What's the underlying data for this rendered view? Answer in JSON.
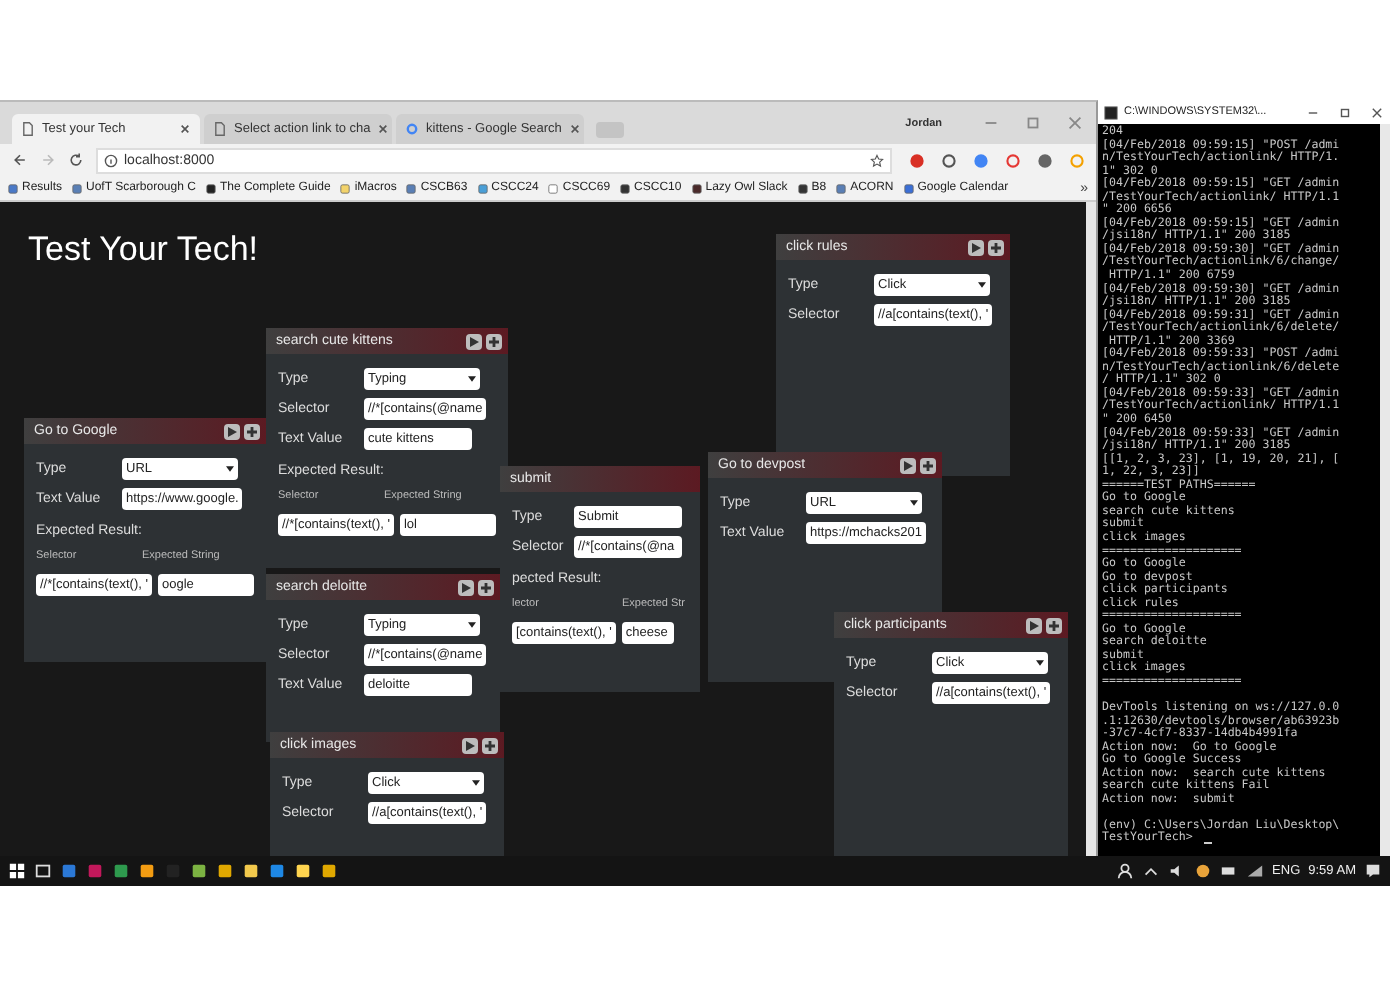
{
  "browser": {
    "tabs": [
      {
        "title": "Test your Tech",
        "selected": true
      },
      {
        "title": "Select action link to cha",
        "selected": false
      },
      {
        "title": "kittens - Google Search",
        "selected": false
      }
    ],
    "user": "Jordan",
    "address": "localhost:8000",
    "bookmarks": [
      "Results",
      "UofT Scarborough C",
      "The Complete Guide",
      "iMacros",
      "CSCB63",
      "CSCC24",
      "CSCC69",
      "CSCC10",
      "Lazy Owl Slack",
      "B8",
      "ACORN",
      "Google Calendar"
    ],
    "bookmarks_more": "»"
  },
  "page": {
    "title": "Test Your Tech!",
    "cards": [
      {
        "title": "Go to Google",
        "fields": [
          {
            "label": "Type",
            "kind": "select",
            "value": "URL"
          },
          {
            "label": "Text Value",
            "kind": "text",
            "value": "https://www.google."
          }
        ],
        "expected": {
          "heading": "Expected Result:",
          "selector_label": "Selector",
          "string_label": "Expected String",
          "selector_value": "//*[contains(text(), '",
          "string_value": "oogle"
        }
      },
      {
        "title": "search cute kittens",
        "fields": [
          {
            "label": "Type",
            "kind": "select",
            "value": "Typing"
          },
          {
            "label": "Selector",
            "kind": "text",
            "value": "//*[contains(@name"
          },
          {
            "label": "Text Value",
            "kind": "text",
            "value": "cute kittens"
          }
        ],
        "expected": {
          "heading": "Expected Result:",
          "selector_label": "Selector",
          "string_label": "Expected String",
          "selector_value": "//*[contains(text(), '",
          "string_value": "lol"
        }
      },
      {
        "title": "submit",
        "fields": [
          {
            "label": "Type",
            "kind": "text",
            "value": "Submit"
          },
          {
            "label": "Selector",
            "kind": "text",
            "value": "//*[contains(@na"
          }
        ],
        "expected": {
          "heading": "pected Result:",
          "selector_label": "lector",
          "string_label": "Expected Str",
          "selector_value": "[contains(text(), '",
          "string_value": "cheese"
        }
      },
      {
        "title": "search deloitte",
        "fields": [
          {
            "label": "Type",
            "kind": "select",
            "value": "Typing"
          },
          {
            "label": "Selector",
            "kind": "text",
            "value": "//*[contains(@name"
          },
          {
            "label": "Text Value",
            "kind": "text",
            "value": "deloitte"
          }
        ]
      },
      {
        "title": "click images",
        "fields": [
          {
            "label": "Type",
            "kind": "select",
            "value": "Click"
          },
          {
            "label": "Selector",
            "kind": "text",
            "value": "//a[contains(text(), '"
          }
        ]
      },
      {
        "title": "click rules",
        "fields": [
          {
            "label": "Type",
            "kind": "select",
            "value": "Click"
          },
          {
            "label": "Selector",
            "kind": "text",
            "value": "//a[contains(text(), '"
          }
        ]
      },
      {
        "title": "Go to devpost",
        "fields": [
          {
            "label": "Type",
            "kind": "select",
            "value": "URL"
          },
          {
            "label": "Text Value",
            "kind": "text",
            "value": "https://mchacks201"
          }
        ]
      },
      {
        "title": "click participants",
        "fields": [
          {
            "label": "Type",
            "kind": "select",
            "value": "Click"
          },
          {
            "label": "Selector",
            "kind": "text",
            "value": "//a[contains(text(), '"
          }
        ]
      }
    ]
  },
  "console": {
    "title": "C:\\WINDOWS\\SYSTEM32\\...",
    "blocks": [
      [
        "204",
        "[04/Feb/2018 09:59:15] \"POST /admi",
        "n/TestYourTech/actionlink/ HTTP/1.",
        "1\" 302 0",
        "[04/Feb/2018 09:59:15] \"GET /admin",
        "/TestYourTech/actionlink/ HTTP/1.1",
        "\" 200 6656",
        "[04/Feb/2018 09:59:15] \"GET /admin",
        "/jsi18n/ HTTP/1.1\" 200 3185",
        "[04/Feb/2018 09:59:30] \"GET /admin",
        "/TestYourTech/actionlink/6/change/",
        " HTTP/1.1\" 200 6759",
        "[04/Feb/2018 09:59:30] \"GET /admin",
        "/jsi18n/ HTTP/1.1\" 200 3185",
        "[04/Feb/2018 09:59:31] \"GET /admin",
        "/TestYourTech/actionlink/6/delete/",
        " HTTP/1.1\" 200 3369",
        "[04/Feb/2018 09:59:33] \"POST /admi",
        "n/TestYourTech/actionlink/6/delete",
        "/ HTTP/1.1\" 302 0",
        "[04/Feb/2018 09:59:33] \"GET /admin",
        "/TestYourTech/actionlink/ HTTP/1.1",
        "\" 200 6450",
        "[04/Feb/2018 09:59:33] \"GET /admin",
        "/jsi18n/ HTTP/1.1\" 200 3185",
        "[[1, 2, 3, 23], [1, 19, 20, 21], [",
        "1, 22, 3, 23]]",
        "======TEST PATHS======",
        "Go to Google",
        "search cute kittens",
        "submit",
        "click images",
        "====================",
        "Go to Google",
        "Go to devpost",
        "click participants",
        "click rules",
        "====================",
        "Go to Google",
        "search deloitte",
        "submit",
        "click images",
        "===================="
      ],
      [
        "DevTools listening on ws://127.0.0",
        ".1:12630/devtools/browser/ab63923b",
        "-37c7-4cf7-8337-14db4b4991fa",
        "Action now:  Go to Google",
        "Go to Google Success",
        "Action now:  search cute kittens",
        "search cute kittens Fail",
        "Action now:  submit"
      ],
      [
        "(env) C:\\Users\\Jordan Liu\\Desktop\\",
        "TestYourTech>"
      ]
    ]
  },
  "taskbar": {
    "language": "ENG",
    "time": "9:59 AM"
  }
}
